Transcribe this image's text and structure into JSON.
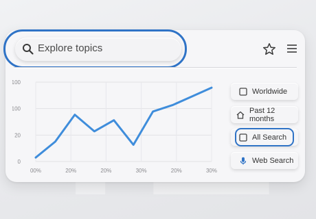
{
  "search": {
    "placeholder": "Explore topics"
  },
  "header": {
    "favorite_icon": "star-icon",
    "menu_icon": "hamburger-menu-icon"
  },
  "filters": [
    {
      "label": "Worldwide",
      "icon": "square-icon"
    },
    {
      "label": "Past 12 months",
      "icon": "house-icon"
    },
    {
      "label": "All Search",
      "icon": "square-icon",
      "selected": true
    },
    {
      "label": "Web Search",
      "icon": "microphone-icon"
    }
  ],
  "colors": {
    "accent": "#2f73c6",
    "line": "#3f8ddb"
  },
  "chart_data": {
    "type": "line",
    "y_tick_labels": [
      "100",
      "100",
      "20",
      "0"
    ],
    "x_tick_labels": [
      "00%",
      "20%",
      "20%",
      "30%",
      "20%",
      "30%"
    ],
    "series": [
      {
        "values": [
          5,
          25,
          59,
          38,
          52,
          21,
          63,
          71,
          82,
          93
        ]
      }
    ],
    "ylim": [
      0,
      100
    ],
    "grid": true
  }
}
